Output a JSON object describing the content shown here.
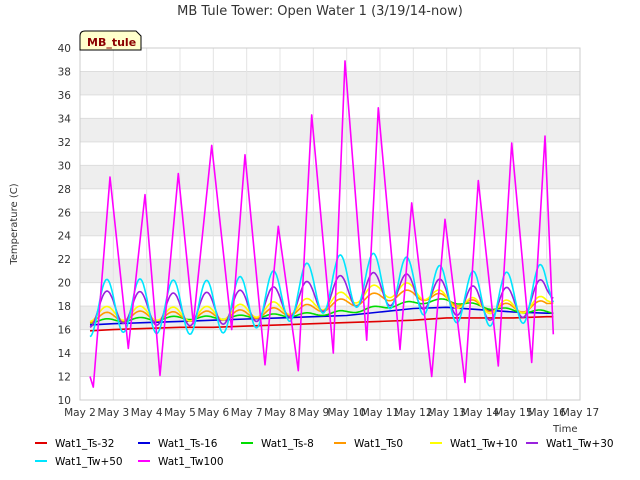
{
  "chart_data": {
    "type": "line",
    "title": "MB Tule Tower: Open Water 1 (3/19/14-now)",
    "station_label": "MB_tule",
    "xlabel": "Time",
    "ylabel": "Temperature (C)",
    "xlim": [
      2,
      17
    ],
    "ylim": [
      10,
      40
    ],
    "x_ticks": [
      {
        "v": 2,
        "label": "May 2"
      },
      {
        "v": 3,
        "label": "May 3"
      },
      {
        "v": 4,
        "label": "May 4"
      },
      {
        "v": 5,
        "label": "May 5"
      },
      {
        "v": 6,
        "label": "May 6"
      },
      {
        "v": 7,
        "label": "May 7"
      },
      {
        "v": 8,
        "label": "May 8"
      },
      {
        "v": 9,
        "label": "May 9"
      },
      {
        "v": 10,
        "label": "May 10"
      },
      {
        "v": 11,
        "label": "May 11"
      },
      {
        "v": 12,
        "label": "May 12"
      },
      {
        "v": 13,
        "label": "May 13"
      },
      {
        "v": 14,
        "label": "May 14"
      },
      {
        "v": 15,
        "label": "May 15"
      },
      {
        "v": 16,
        "label": "May 16"
      },
      {
        "v": 17,
        "label": "May 17"
      }
    ],
    "y_ticks": [
      10,
      12,
      14,
      16,
      18,
      20,
      22,
      24,
      26,
      28,
      30,
      32,
      34,
      36,
      38,
      40
    ],
    "grid": true,
    "banded_background": true,
    "legend_position": "bottom",
    "series": [
      {
        "name": "Wat1_Ts-32",
        "color": "#e00000",
        "x": [
          2.3,
          3,
          4,
          5,
          6,
          7,
          8,
          9,
          10,
          11,
          12,
          13,
          14,
          15,
          16,
          16.2
        ],
        "y": [
          15.9,
          16.0,
          16.1,
          16.2,
          16.2,
          16.3,
          16.4,
          16.5,
          16.6,
          16.7,
          16.8,
          17.0,
          17.0,
          17.0,
          17.1,
          17.1
        ]
      },
      {
        "name": "Wat1_Ts-16",
        "color": "#0000e0",
        "x": [
          2.3,
          3,
          4,
          5,
          6,
          7,
          8,
          9,
          10,
          11,
          12,
          13,
          14,
          15,
          16,
          16.2
        ],
        "y": [
          16.4,
          16.5,
          16.6,
          16.7,
          16.8,
          16.9,
          17.0,
          17.1,
          17.2,
          17.5,
          17.8,
          17.9,
          17.7,
          17.5,
          17.4,
          17.4
        ]
      },
      {
        "name": "Wat1_Ts-8",
        "color": "#00dd00",
        "x": [
          2.3,
          3,
          4,
          5,
          6,
          7,
          8,
          9,
          10,
          11,
          12,
          13,
          14,
          15,
          16,
          16.2
        ],
        "y": [
          16.7,
          16.8,
          16.9,
          17.0,
          17.0,
          17.1,
          17.2,
          17.3,
          17.5,
          17.9,
          18.3,
          18.5,
          18.0,
          17.6,
          17.5,
          17.5
        ],
        "amp": 0.15
      },
      {
        "name": "Wat1_Ts0",
        "color": "#ff9900",
        "x": [
          2.3,
          3,
          4,
          5,
          6,
          7,
          8,
          9,
          10,
          11,
          12,
          13,
          14,
          15,
          16,
          16.2
        ],
        "y": [
          17.0,
          17.1,
          17.2,
          17.1,
          17.2,
          17.3,
          17.5,
          17.8,
          18.3,
          18.8,
          19.0,
          18.6,
          18.0,
          17.8,
          18.1,
          18.6
        ],
        "amp": 0.4
      },
      {
        "name": "Wat1_Tw+10",
        "color": "#ffff00",
        "x": [
          2.3,
          3,
          4,
          5,
          6,
          7,
          8,
          9,
          10,
          11,
          12,
          13,
          14,
          15,
          16,
          16.2
        ],
        "y": [
          17.3,
          17.4,
          17.4,
          17.3,
          17.4,
          17.6,
          17.8,
          18.1,
          18.7,
          19.3,
          19.4,
          18.6,
          18.0,
          17.9,
          18.3,
          18.8
        ],
        "amp": 0.6
      },
      {
        "name": "Wat1_Tw+30",
        "color": "#9922dd",
        "x": [
          2.3,
          3,
          4,
          5,
          6,
          7,
          8,
          9,
          10,
          11,
          12,
          13,
          14,
          15,
          16,
          16.2
        ],
        "y": [
          17.6,
          18.0,
          17.8,
          17.7,
          17.8,
          18.0,
          18.3,
          18.8,
          19.3,
          19.5,
          19.3,
          18.8,
          18.2,
          18.2,
          19.0,
          19.8
        ],
        "amp": 1.4
      },
      {
        "name": "Wat1_Tw+50",
        "color": "#00e5ff",
        "x": [
          2.3,
          3,
          4,
          5,
          6,
          7,
          8,
          9,
          10,
          11,
          12,
          13,
          14,
          15,
          16,
          16.2
        ],
        "y": [
          17.7,
          18.1,
          18.0,
          17.9,
          17.9,
          18.3,
          18.8,
          19.5,
          20.2,
          20.2,
          19.8,
          19.0,
          18.6,
          18.6,
          19.4,
          20.2
        ],
        "amp": 2.3
      },
      {
        "name": "Wat1_Tw100",
        "color": "#ff00ff",
        "x": [
          2.3,
          2.4,
          2.9,
          3.45,
          3.95,
          4.4,
          4.95,
          5.4,
          5.95,
          6.55,
          6.95,
          7.55,
          7.95,
          8.55,
          8.95,
          9.6,
          9.95,
          10.6,
          10.95,
          11.6,
          11.95,
          12.55,
          12.95,
          13.55,
          13.95,
          14.55,
          14.95,
          15.55,
          15.95,
          16.2
        ],
        "y": [
          12.0,
          11.1,
          29.0,
          14.4,
          27.5,
          12.1,
          29.3,
          16.5,
          31.7,
          16.0,
          30.9,
          13.0,
          24.8,
          12.5,
          34.3,
          14.0,
          38.9,
          15.1,
          34.9,
          14.3,
          26.8,
          12.0,
          25.4,
          11.5,
          28.7,
          12.9,
          31.9,
          13.2,
          32.5,
          15.6
        ]
      }
    ]
  }
}
